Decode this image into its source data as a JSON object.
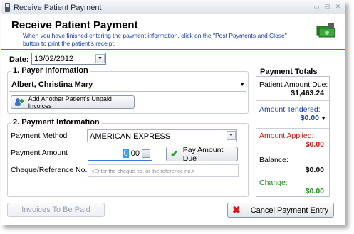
{
  "window": {
    "title": "Receive Patient Payment",
    "controls": [
      "▭",
      "⊟",
      "✕"
    ]
  },
  "header": {
    "title": "Receive Patient Payment",
    "subtitle": "When you have finished entering the payment information, click on the \"Post Payments and Close\" button to print the patient's receipt."
  },
  "date": {
    "label": "Date:",
    "value": "13/02/2012"
  },
  "payer": {
    "section_title": "1. Payer Information",
    "name": "Albert, Christina Mary",
    "add_button_label": "Add Another Patient's Unpaid Invoices"
  },
  "payment": {
    "section_title": "2. Payment Information",
    "method_label": "Payment Method",
    "method_value": "AMERICAN EXPRESS",
    "amount_label": "Payment Amount",
    "amount_sel": "0",
    "amount_rest": ".00",
    "pay_due_button": "Pay Amount Due",
    "cheque_label": "Cheque/Reference No.",
    "cheque_placeholder": "<Enter the cheque no. or the reference no.>"
  },
  "totals": {
    "title": "Payment Totals",
    "amount_due_label": "Patient Amount Due:",
    "amount_due_value": "$1,463.24",
    "tendered_label": "Amount Tendered:",
    "tendered_value": "$0.00",
    "applied_label": "Amount Applied:",
    "applied_value": "$0.00",
    "balance_label": "Balance:",
    "balance_value": "$0.00",
    "change_label": "Change:",
    "change_value": "$0.00"
  },
  "footer": {
    "invoices_button": "Invoices To Be Paid",
    "cancel_button": "Cancel Payment Entry"
  },
  "colors": {
    "accent_blue": "#1a3fa8",
    "applied_red": "#d11111",
    "change_green": "#1f8a1f",
    "header_rule": "#3c6fd8"
  }
}
